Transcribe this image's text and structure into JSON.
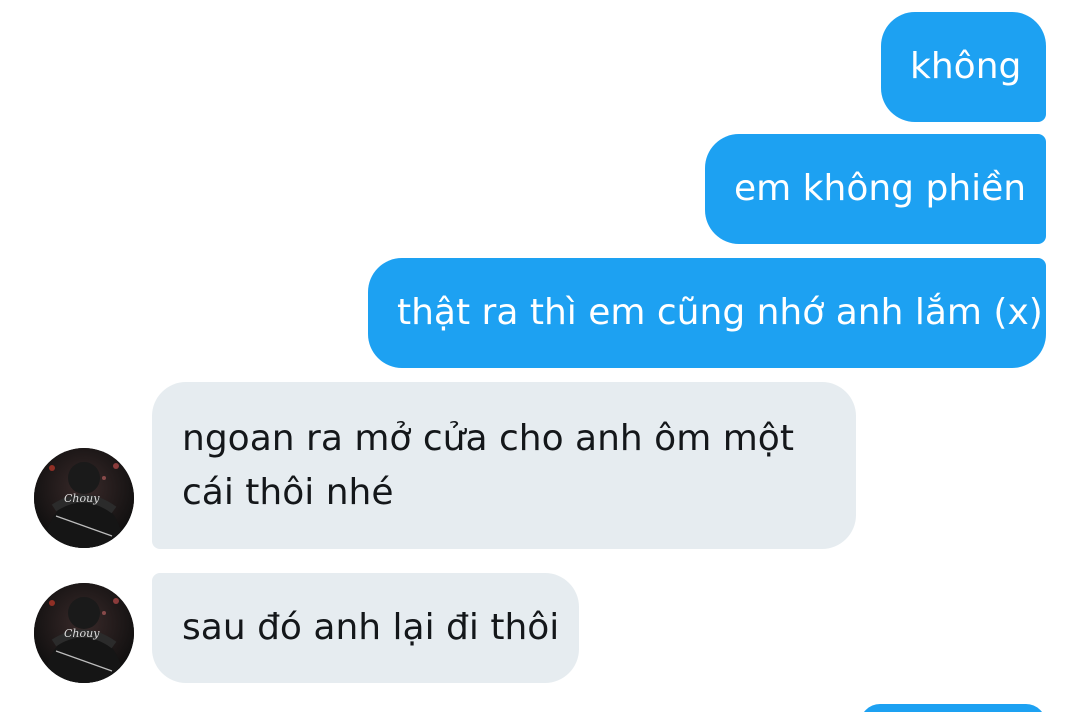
{
  "conversation": {
    "messages": [
      {
        "direction": "sent",
        "text": "không"
      },
      {
        "direction": "sent",
        "text": "em không phiền"
      },
      {
        "direction": "sent",
        "text": "thật ra thì em cũng nhớ anh lắm (x)"
      },
      {
        "direction": "received",
        "text": "ngoan ra mở cửa cho anh ôm một cái thôi nhé"
      },
      {
        "direction": "received",
        "text": "sau đó anh lại đi thôi"
      }
    ],
    "avatar": {
      "icon": "user-avatar-icon",
      "logo_text": "Chouy"
    }
  },
  "colors": {
    "sent_bubble": "#1da1f2",
    "sent_text": "#ffffff",
    "received_bubble": "#e6ecf0",
    "received_text": "#14171a",
    "background": "#ffffff"
  }
}
